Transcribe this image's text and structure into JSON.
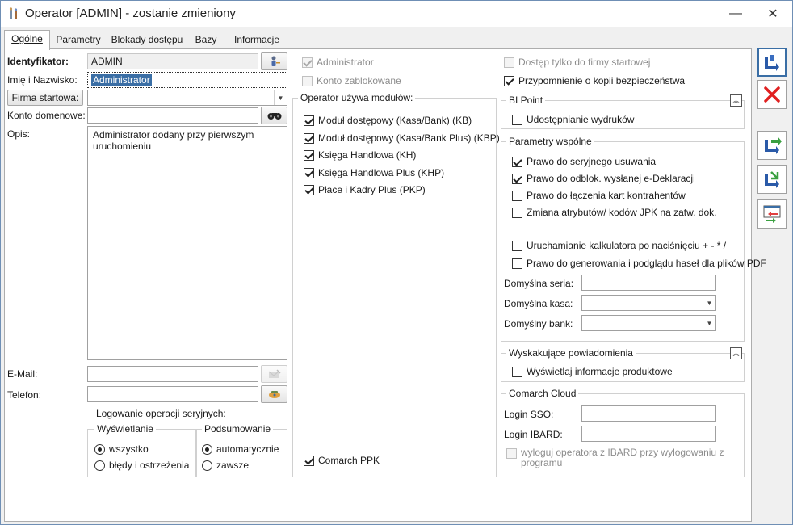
{
  "window": {
    "title": "Operator [ADMIN] - zostanie zmieniony",
    "minimize": "—",
    "close": "✕"
  },
  "tabs": [
    {
      "label": "Ogólne"
    },
    {
      "label": "Parametry"
    },
    {
      "label": "Blokady dostępu"
    },
    {
      "label": "Bazy"
    },
    {
      "label": "Informacje"
    }
  ],
  "general": {
    "identifier_label": "Identyfikator:",
    "identifier_value": "ADMIN",
    "name_label": "Imię i Nazwisko:",
    "name_value": "Administrator",
    "start_company_button": "Firma startowa:",
    "start_company_value": "",
    "domain_account_label": "Konto domenowe:",
    "domain_account_value": "",
    "description_label": "Opis:",
    "description_value": "Administrator dodany przy pierwszym uruchomieniu",
    "email_label": "E-Mail:",
    "email_value": "",
    "phone_label": "Telefon:",
    "phone_value": ""
  },
  "logging": {
    "title": "Logowanie operacji seryjnych:",
    "display_title": "Wyświetlanie",
    "display_all": "wszystko",
    "display_errors": "błędy i ostrzeżenia",
    "summary_title": "Podsumowanie",
    "summary_auto": "automatycznie",
    "summary_always": "zawsze"
  },
  "flags": {
    "administrator": "Administrator",
    "account_locked": "Konto zablokowane",
    "start_company_only": "Dostęp tylko do firmy startowej",
    "backup_reminder": "Przypomnienie o kopii bezpieczeństwa"
  },
  "modules": {
    "title": "Operator używa modułów:",
    "items": [
      {
        "label": "Moduł dostępowy (Kasa/Bank) (KB)"
      },
      {
        "label": "Moduł dostępowy (Kasa/Bank Plus) (KBP)"
      },
      {
        "label": "Księga Handlowa (KH)"
      },
      {
        "label": "Księga Handlowa Plus (KHP)"
      },
      {
        "label": "Płace i Kadry Plus (PKP)"
      }
    ],
    "ppk": "Comarch PPK"
  },
  "bi_point": {
    "title": "BI Point",
    "share_prints": "Udostępnianie wydruków"
  },
  "common": {
    "title": "Parametry wspólne",
    "items": [
      {
        "label": "Prawo do seryjnego usuwania"
      },
      {
        "label": "Prawo do odblok. wysłanej e-Deklaracji"
      },
      {
        "label": "Prawo do łączenia kart kontrahentów"
      },
      {
        "label": "Zmiana atrybutów/ kodów JPK na zatw. dok."
      },
      {
        "label": "Uruchamianie kalkulatora po naciśnięciu + - * /"
      },
      {
        "label": "Prawo do generowania i podglądu haseł dla plików PDF"
      }
    ],
    "series_label": "Domyślna seria:",
    "cash_label": "Domyślna kasa:",
    "bank_label": "Domyślny bank:"
  },
  "popups": {
    "title": "Wyskakujące powiadomienia",
    "product_info": "Wyświetlaj informacje produktowe"
  },
  "cloud": {
    "title": "Comarch Cloud",
    "sso_label": "Login SSO:",
    "ibard_label": "Login IBARD:",
    "logout_ibard": "wyloguj operatora z IBARD przy wylogowaniu z programu"
  },
  "collapse_glyph": "︽"
}
